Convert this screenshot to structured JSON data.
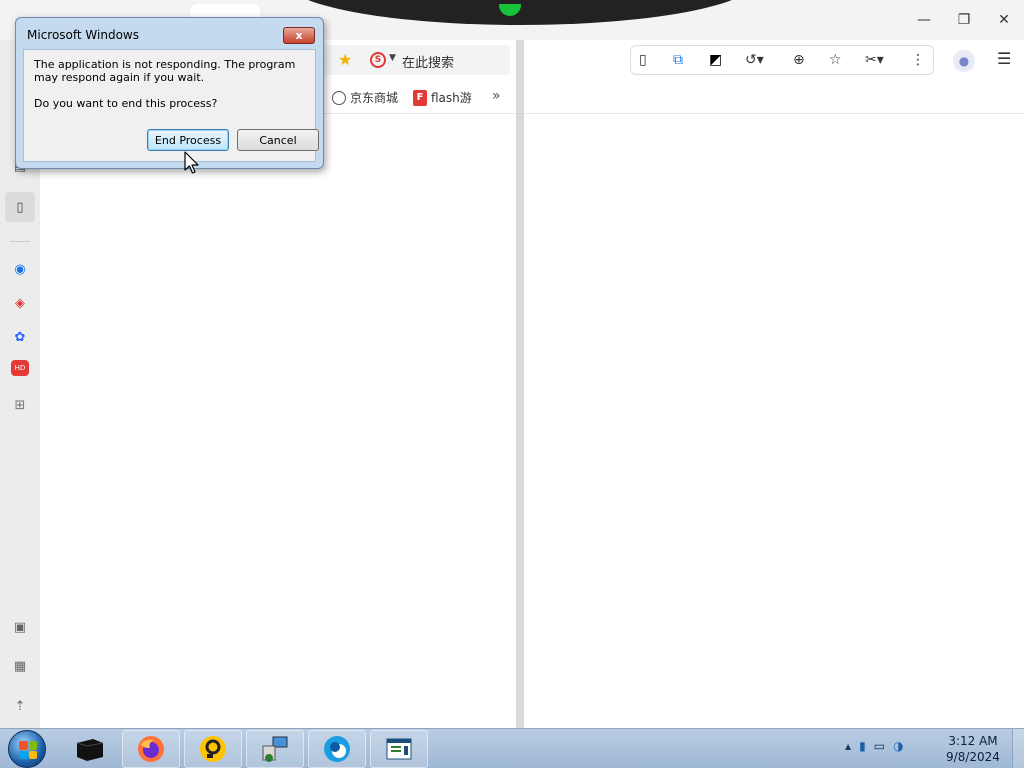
{
  "browser": {
    "window_controls": {
      "minimize_icon": "minimize-icon",
      "restore_icon": "restore-icon",
      "close_icon": "close-icon"
    },
    "search_engine": {
      "label": "在此搜索"
    },
    "bookmarks": [
      {
        "label": "京东商城",
        "icon": "globe-icon"
      },
      {
        "label": "flash游",
        "icon": "flash-game-icon"
      }
    ],
    "bookmarks_more": "»"
  },
  "dialog": {
    "title": "Microsoft Windows",
    "close_glyph": "x",
    "message": "The application is not responding. The program may respond again if you wait.",
    "question": "Do you want to end this process?",
    "end_process_label": "End Process",
    "cancel_label": "Cancel"
  },
  "taskbar": {
    "clock_time": "3:12 AM",
    "clock_date": "9/8/2024",
    "tray_arrow": "▲"
  },
  "colors": {
    "accent_star": "#f3b400",
    "search_brand": "#e53935",
    "dialog_frame": "#c4daee",
    "taskbar": "#b9cde3"
  }
}
